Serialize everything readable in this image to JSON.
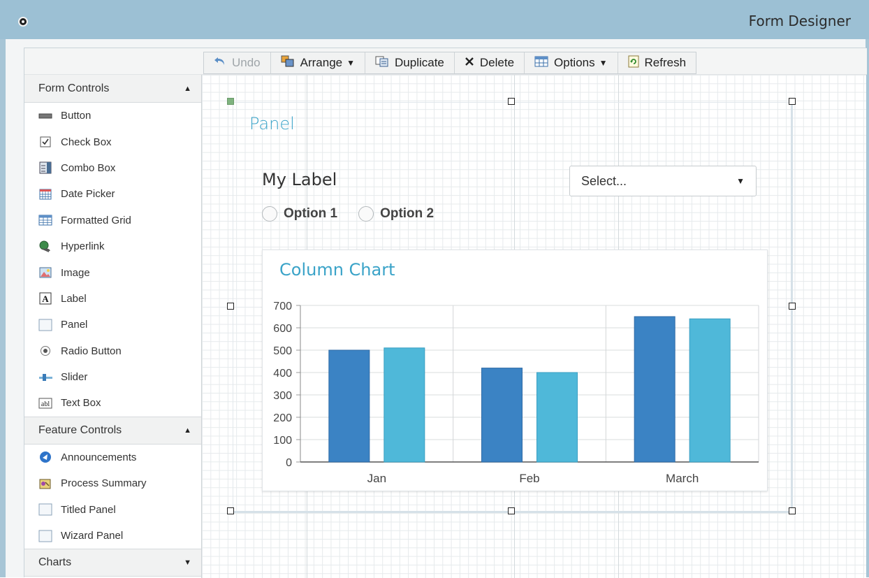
{
  "app": {
    "title": "Form Designer"
  },
  "toolbar": {
    "buttons": [
      {
        "label": "Undo",
        "icon": "undo-icon",
        "disabled": true
      },
      {
        "label": "Arrange",
        "icon": "arrange-icon",
        "dropdown": true
      },
      {
        "label": "Duplicate",
        "icon": "duplicate-icon"
      },
      {
        "label": "Delete",
        "icon": "delete-icon"
      },
      {
        "label": "Options",
        "icon": "options-icon",
        "dropdown": true
      },
      {
        "label": "Refresh",
        "icon": "refresh-icon"
      }
    ],
    "dropdown_glyph": "▼"
  },
  "sidebar": {
    "sections": [
      {
        "title": "Form Controls",
        "expanded": true,
        "items": [
          {
            "label": "Button",
            "icon": "button-icon"
          },
          {
            "label": "Check Box",
            "icon": "checkbox-icon"
          },
          {
            "label": "Combo Box",
            "icon": "combobox-icon"
          },
          {
            "label": "Date Picker",
            "icon": "calendar-icon"
          },
          {
            "label": "Formatted Grid",
            "icon": "grid-icon"
          },
          {
            "label": "Hyperlink",
            "icon": "hyperlink-icon"
          },
          {
            "label": "Image",
            "icon": "image-icon"
          },
          {
            "label": "Label",
            "icon": "label-icon"
          },
          {
            "label": "Panel",
            "icon": "panel-icon"
          },
          {
            "label": "Radio Button",
            "icon": "radio-icon"
          },
          {
            "label": "Slider",
            "icon": "slider-icon"
          },
          {
            "label": "Text Box",
            "icon": "textbox-icon"
          }
        ]
      },
      {
        "title": "Feature Controls",
        "expanded": true,
        "items": [
          {
            "label": "Announcements",
            "icon": "announcements-icon"
          },
          {
            "label": "Process Summary",
            "icon": "process-summary-icon"
          },
          {
            "label": "Titled Panel",
            "icon": "panel-icon"
          },
          {
            "label": "Wizard Panel",
            "icon": "panel-icon"
          }
        ]
      },
      {
        "title": "Charts",
        "expanded": false,
        "items": []
      }
    ]
  },
  "canvas": {
    "panel_title": "Panel",
    "label_text": "My Label",
    "select": {
      "value": "Select..."
    },
    "radios": [
      {
        "label": "Option 1"
      },
      {
        "label": "Option 2"
      }
    ],
    "chart_title": "Column Chart"
  },
  "colors": {
    "series1": "#3b83c4",
    "series2": "#4fb8d9",
    "accent_title": "#3aa3c8"
  },
  "chart_data": {
    "type": "bar",
    "title": "Column Chart",
    "categories": [
      "Jan",
      "Feb",
      "March"
    ],
    "series": [
      {
        "values": [
          500,
          420,
          650
        ]
      },
      {
        "values": [
          510,
          400,
          640
        ]
      }
    ],
    "ylim": [
      0,
      700
    ],
    "yticks": [
      0,
      100,
      200,
      300,
      400,
      500,
      600,
      700
    ],
    "grid": true,
    "xlabel": "",
    "ylabel": ""
  }
}
